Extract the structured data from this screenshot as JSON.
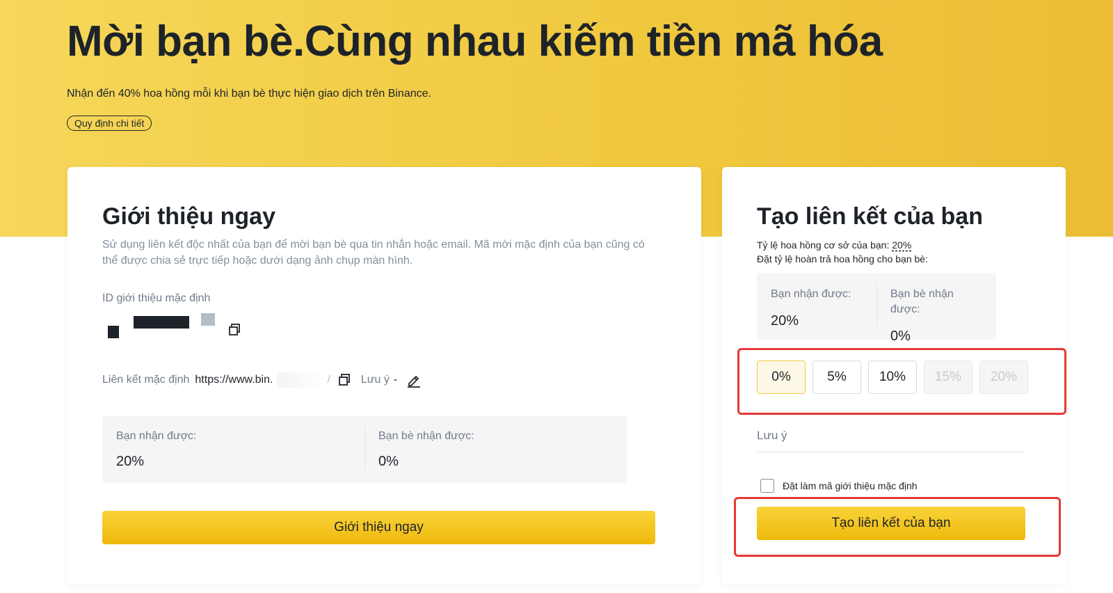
{
  "hero": {
    "title": "Mời bạn bè.Cùng nhau kiếm tiền mã hóa",
    "subtitle": "Nhận đến 40% hoa hồng mỗi khi bạn bè thực hiện giao dịch trên Binance.",
    "rules_label": "Quy định chi tiết"
  },
  "left_card": {
    "title": "Giới thiệu ngay",
    "description": "Sử dụng liên kết độc nhất của bạn để mời bạn bè qua tin nhắn hoặc email. Mã mời mặc định của bạn cũng có thể được chia sẻ trực tiếp hoặc dưới dạng ảnh chụp màn hình.",
    "ref_id_label": "ID giới thiệu mặc định",
    "link_label": "Liên kết mặc định",
    "link_value": "https://www.bin.",
    "link_suffix": "/",
    "note_label": "Lưu ý",
    "note_value": "-",
    "you_receive_label": "Bạn nhận được:",
    "you_receive_value": "20%",
    "friend_receive_label": "Bạn bè nhận được:",
    "friend_receive_value": "0%",
    "button_label": "Giới thiệu ngay"
  },
  "right_card": {
    "title": "Tạo liên kết của bạn",
    "base_rate_label": "Tỷ lệ hoa hồng cơ sở của bạn:",
    "base_rate_value": "20%",
    "set_rate_label": "Đặt tỷ lệ hoàn trả hoa hồng cho bạn bè:",
    "you_receive_label": "Bạn nhận được:",
    "you_receive_value": "20%",
    "friend_receive_label": "Bạn bè nhận được:",
    "friend_receive_value": "0%",
    "percent_options": [
      "0%",
      "5%",
      "10%",
      "15%",
      "20%"
    ],
    "selected_option": "0%",
    "note_placeholder": "Lưu ý",
    "default_checkbox_label": "Đặt làm mã giới thiệu mặc định",
    "button_label": "Tạo liên kết của bạn"
  },
  "colors": {
    "brand_yellow": "#f0b90b",
    "highlight_red": "#e53935"
  }
}
